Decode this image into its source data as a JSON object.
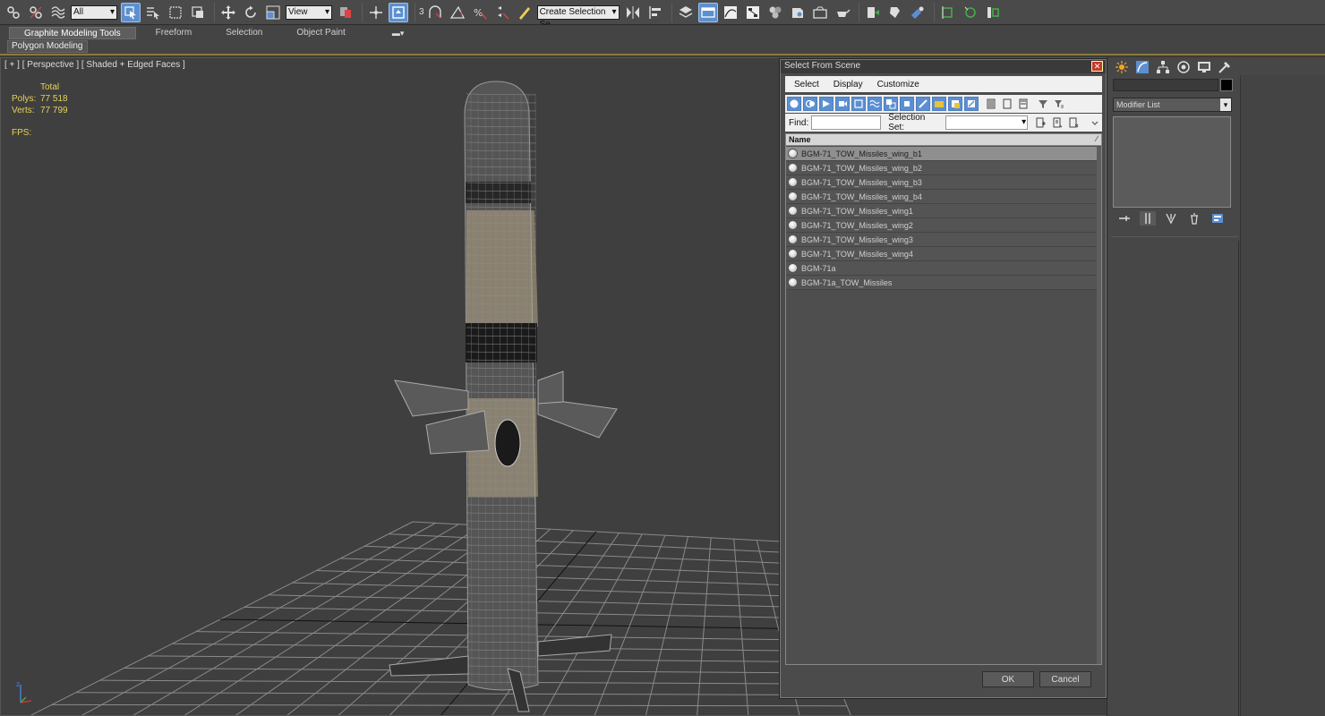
{
  "toolbar": {
    "selection_filter": "All",
    "reference_coord": "View",
    "snap_label": "3",
    "named_selection_set": "Create Selection Se"
  },
  "ribbon": {
    "tabs": [
      {
        "label": "Graphite Modeling Tools",
        "active": true
      },
      {
        "label": "Freeform",
        "active": false
      },
      {
        "label": "Selection",
        "active": false
      },
      {
        "label": "Object Paint",
        "active": false
      }
    ],
    "panel_label": "Polygon Modeling"
  },
  "viewport": {
    "label": "[ + ] [ Perspective ] [ Shaded + Edged Faces ]",
    "stats": {
      "header": "Total",
      "polys_label": "Polys:",
      "polys_value": "77 518",
      "verts_label": "Verts:",
      "verts_value": "77 799",
      "fps_label": "FPS:"
    },
    "gizmo_axis": "z"
  },
  "command_panel": {
    "modifier_list": "Modifier List"
  },
  "dialog": {
    "title": "Select From Scene",
    "menu": [
      "Select",
      "Display",
      "Customize"
    ],
    "find_label": "Find:",
    "find_value": "",
    "selection_set_label": "Selection Set:",
    "selection_set_value": "",
    "column_name": "Name",
    "items": [
      {
        "name": "BGM-71_TOW_Missiles_wing_b1",
        "selected": true
      },
      {
        "name": "BGM-71_TOW_Missiles_wing_b2",
        "selected": false
      },
      {
        "name": "BGM-71_TOW_Missiles_wing_b3",
        "selected": false
      },
      {
        "name": "BGM-71_TOW_Missiles_wing_b4",
        "selected": false
      },
      {
        "name": "BGM-71_TOW_Missiles_wing1",
        "selected": false
      },
      {
        "name": "BGM-71_TOW_Missiles_wing2",
        "selected": false
      },
      {
        "name": "BGM-71_TOW_Missiles_wing3",
        "selected": false
      },
      {
        "name": "BGM-71_TOW_Missiles_wing4",
        "selected": false
      },
      {
        "name": "BGM-71a",
        "selected": false
      },
      {
        "name": "BGM-71a_TOW_Missiles",
        "selected": false
      }
    ],
    "ok_label": "OK",
    "cancel_label": "Cancel"
  },
  "colors": {
    "accent": "#5b8fd1",
    "stats_text": "#e8d25a",
    "viewport_bg": "#3f3f3f",
    "close_button": "#c9382f"
  }
}
